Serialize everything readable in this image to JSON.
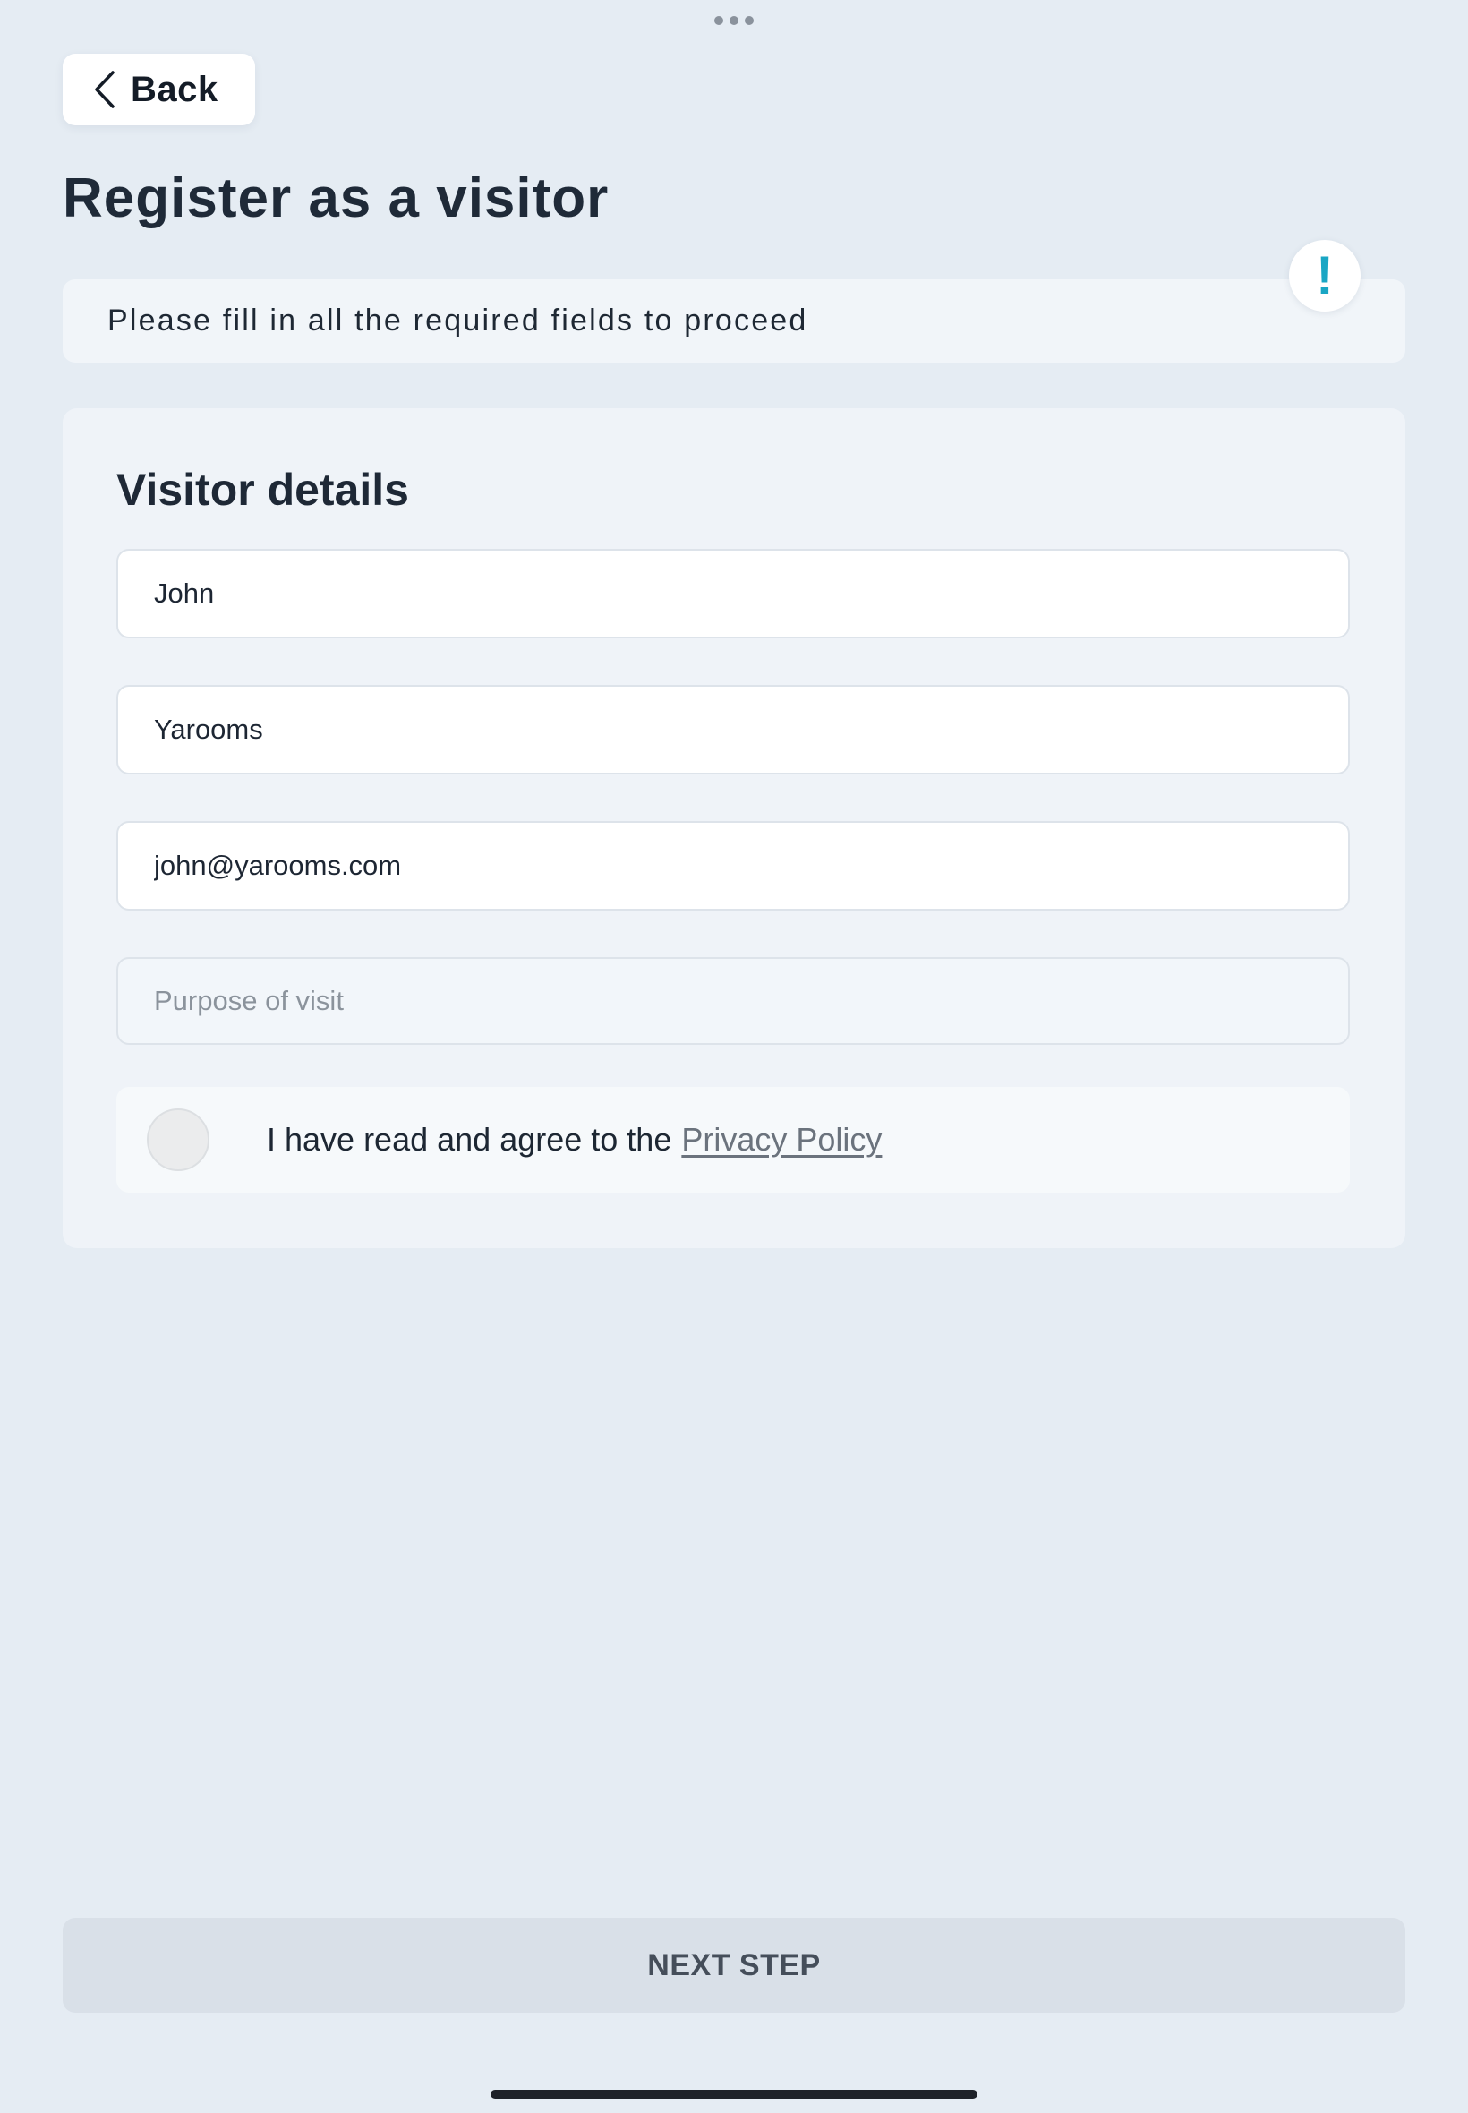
{
  "header": {
    "back_label": "Back",
    "title": "Register as a visitor"
  },
  "notice": {
    "text": "Please fill in all the required fields to proceed",
    "badge": "!"
  },
  "visitor_details": {
    "title": "Visitor details",
    "fields": {
      "first_name": {
        "value": "John"
      },
      "last_name": {
        "value": "Yarooms"
      },
      "email": {
        "value": "john@yarooms.com"
      },
      "purpose": {
        "value": "",
        "placeholder": "Purpose of visit"
      }
    },
    "privacy": {
      "checked": false,
      "text": "I have read and agree to the",
      "link_label": "Privacy Policy"
    }
  },
  "footer": {
    "next_label": "NEXT STEP"
  },
  "icons": {
    "back": "chevron-left-icon",
    "alert": "exclamation-icon",
    "multitask": "more-dots-icon"
  },
  "colors": {
    "background": "#e5ecf3",
    "accent": "#1aa6c4",
    "button_disabled": "#d9e0e8"
  }
}
